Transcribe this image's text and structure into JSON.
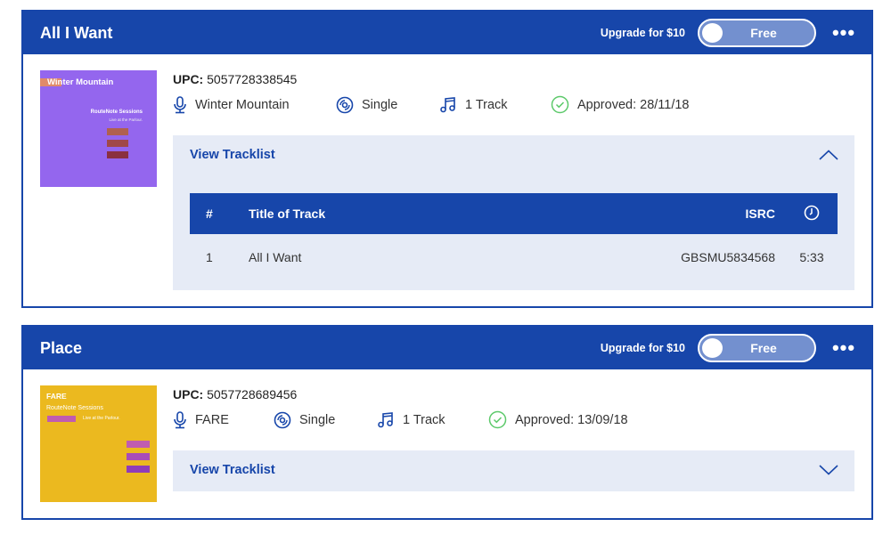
{
  "releases": [
    {
      "title": "All I Want",
      "upgrade_label": "Upgrade for $10",
      "plan_toggle_label": "Free",
      "more_label": "•••",
      "cover": {
        "title": "Winter Mountain",
        "line1": "RouteNote Sessions",
        "line2": "Live at the Parlour.",
        "bg": "#9466ee"
      },
      "upc_label": "UPC:",
      "upc": "5057728338545",
      "artist": "Winter Mountain",
      "type": "Single",
      "tracks": "1 Track",
      "status": "Approved: 28/11/18",
      "tracklist_label": "View Tracklist",
      "tracklist_expanded": true,
      "table": {
        "headers": [
          "#",
          "Title of Track",
          "ISRC",
          "clock-icon"
        ],
        "rows": [
          {
            "num": "1",
            "title": "All I Want",
            "isrc": "GBSMU5834568",
            "duration": "5:33"
          }
        ]
      }
    },
    {
      "title": "Place",
      "upgrade_label": "Upgrade for $10",
      "plan_toggle_label": "Free",
      "more_label": "•••",
      "cover": {
        "title": "FARE",
        "line1": "RouteNote Sessions",
        "line2": "Live at the Parlour.",
        "bg": "#ebb91f"
      },
      "upc_label": "UPC:",
      "upc": "5057728689456",
      "artist": "FARE",
      "type": "Single",
      "tracks": "1 Track",
      "status": "Approved: 13/09/18",
      "tracklist_label": "View Tracklist",
      "tracklist_expanded": false
    }
  ],
  "colors": {
    "brand": "#1746aa",
    "approved": "#5cc96a",
    "panel": "#e6ebf6"
  }
}
